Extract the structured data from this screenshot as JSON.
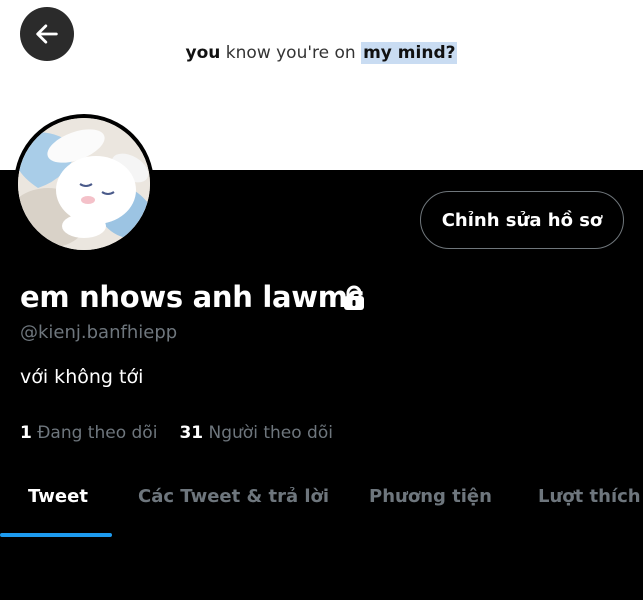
{
  "banner": {
    "text_part1": "you",
    "text_part2": " know you're on ",
    "text_highlight": "my mind?"
  },
  "profile": {
    "edit_button_label": "Chỉnh sửa hồ sơ",
    "display_name": "em nhows anh lawms",
    "handle": "@kienj.banfhiepp",
    "bio": "với không tới",
    "following_count": "1",
    "following_label": "Đang theo dõi",
    "followers_count": "31",
    "followers_label": "Người theo dõi"
  },
  "tabs": [
    {
      "label": "Tweet",
      "active": true
    },
    {
      "label": "Các Tweet & trả lời",
      "active": false
    },
    {
      "label": "Phương tiện",
      "active": false
    },
    {
      "label": "Lượt thích",
      "active": false
    }
  ],
  "colors": {
    "accent": "#1d9bf0",
    "background": "#000000",
    "muted_text": "#6e767d",
    "banner_bg": "#ffffff",
    "highlight": "#c9dcf2"
  },
  "icons": {
    "back": "arrow-left-icon",
    "lock": "lock-icon"
  }
}
